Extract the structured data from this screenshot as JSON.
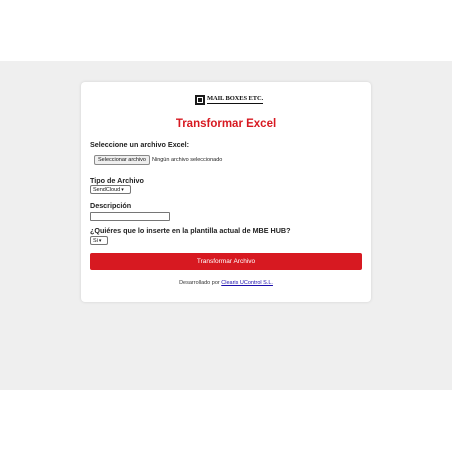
{
  "brand": {
    "logo_text": "MAIL BOXES ETC."
  },
  "form": {
    "title": "Transformar Excel",
    "file_label": "Seleccione un archivo Excel:",
    "file_button": "Seleccionar archivo",
    "file_status": "Ningún archivo seleccionado",
    "type_label": "Tipo de Archivo",
    "type_selected": "SendCloud",
    "description_label": "Descripción",
    "description_value": "",
    "insert_label": "¿Quiéres que lo inserte en la plantilla actual de MBE HUB?",
    "insert_selected": "Si",
    "submit_label": "Transformar Archivo"
  },
  "footer": {
    "prefix": "Desarrollado por",
    "link_text": "Clearis UControl S.L."
  }
}
